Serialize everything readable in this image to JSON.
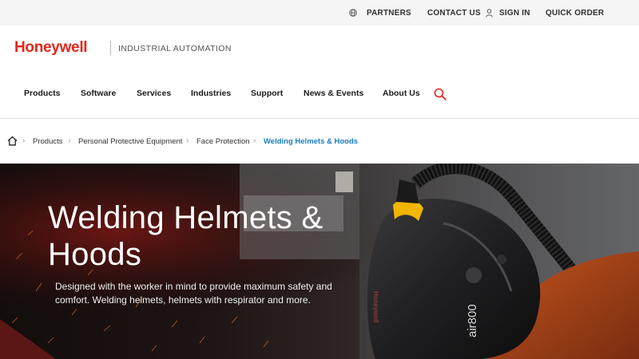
{
  "utility": {
    "partners": "PARTNERS",
    "contact": "CONTACT US",
    "sign_in": "SIGN IN",
    "quick_order": "QUICK ORDER"
  },
  "brand": {
    "logo": "Honeywell",
    "division": "INDUSTRIAL AUTOMATION",
    "color": "#e4261c"
  },
  "nav": {
    "items": [
      "Products",
      "Software",
      "Services",
      "Industries",
      "Support",
      "News & Events",
      "About Us"
    ],
    "search_icon": "search-icon"
  },
  "breadcrumb": {
    "items": [
      "Products",
      "Personal Protective Equipment",
      "Face Protection",
      "Welding Helmets & Hoods"
    ],
    "link_color": "#1a7dbf"
  },
  "hero": {
    "title_line1": "Welding Helmets &",
    "title_line2": "Hoods",
    "description": "Designed with the worker in mind to provide maximum safety and comfort. Welding helmets, helmets with respirator and more.",
    "helmet_brand": "Honeywell",
    "helmet_model": "air800"
  }
}
